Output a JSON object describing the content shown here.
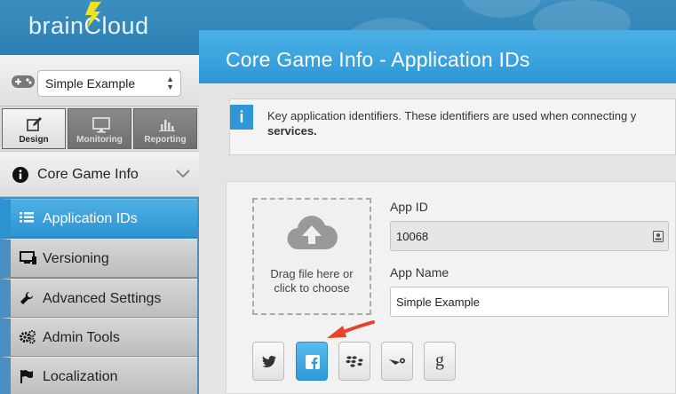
{
  "brand": {
    "logo_text": "brainCloud"
  },
  "sidebar": {
    "app_selector": {
      "selected": "Simple Example"
    },
    "modes": [
      {
        "label": "Design",
        "active": true
      },
      {
        "label": "Monitoring",
        "active": false
      },
      {
        "label": "Reporting",
        "active": false
      }
    ],
    "section": {
      "label": "Core Game Info"
    },
    "items": [
      {
        "label": "Application IDs",
        "icon": "list-icon",
        "active": true
      },
      {
        "label": "Versioning",
        "icon": "monitor-icon",
        "active": false
      },
      {
        "label": "Advanced Settings",
        "icon": "wrench-icon",
        "active": false
      },
      {
        "label": "Admin Tools",
        "icon": "gears-icon",
        "active": false
      },
      {
        "label": "Localization",
        "icon": "flag-icon",
        "active": false
      }
    ]
  },
  "main": {
    "title": "Core Game Info - Application IDs",
    "info": {
      "badge": "i",
      "line1": "Key application identifiers. These identifiers are used when connecting y",
      "line2": "services."
    },
    "upload": {
      "text": "Drag file here or click to choose"
    },
    "app_id": {
      "label": "App ID",
      "value": "10068"
    },
    "app_name": {
      "label": "App Name",
      "value": "Simple Example"
    },
    "social_buttons": [
      {
        "name": "twitter",
        "icon": "twitter-icon",
        "selected": false
      },
      {
        "name": "facebook",
        "icon": "facebook-icon",
        "selected": true
      },
      {
        "name": "blackberry",
        "icon": "blackberry-icon",
        "selected": false
      },
      {
        "name": "steam",
        "icon": "steam-icon",
        "selected": false
      },
      {
        "name": "google",
        "icon": "google-icon",
        "glyph": "g",
        "selected": false
      }
    ]
  },
  "colors": {
    "accent": "#2e97d6",
    "annotation_arrow": "#e8432a"
  }
}
